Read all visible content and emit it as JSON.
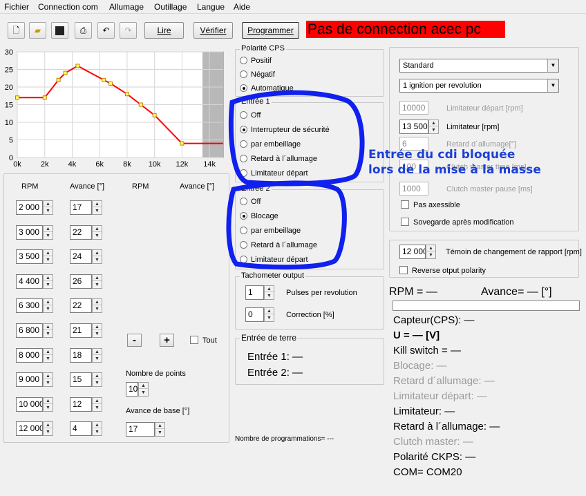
{
  "menu": [
    "Fichier",
    "Connection com",
    "Allumage",
    "Outillage",
    "Langue",
    "Aide"
  ],
  "toolbar": {
    "read_label": "Lire",
    "verify_label": "Vérifier",
    "program_label": "Programmer",
    "status": "Pas de connection acec pc",
    "status_color": "#ff0000"
  },
  "chart_data": {
    "type": "line",
    "x": [
      0,
      2000,
      3000,
      3500,
      4400,
      6300,
      6800,
      8000,
      9000,
      10000,
      12000,
      15000
    ],
    "values": [
      17,
      17,
      22,
      24,
      26,
      22,
      21,
      18,
      15,
      12,
      4,
      4
    ],
    "ylim": [
      0,
      30
    ],
    "xlim": [
      0,
      15000
    ],
    "yticks": [
      "0",
      "5",
      "10",
      "15",
      "20",
      "25",
      "30"
    ],
    "xticks": [
      "0k",
      "2k",
      "4k",
      "6k",
      "8k",
      "10k",
      "12k",
      "14k"
    ],
    "grid": true,
    "line_color": "#ff0000"
  },
  "table": {
    "headers": [
      "RPM",
      "Avance [°]",
      "RPM",
      "Avance [°]"
    ],
    "rows": [
      {
        "rpm": "2 000",
        "adv": "17"
      },
      {
        "rpm": "3 000",
        "adv": "22"
      },
      {
        "rpm": "3 500",
        "adv": "24"
      },
      {
        "rpm": "4 400",
        "adv": "26"
      },
      {
        "rpm": "6 300",
        "adv": "22"
      },
      {
        "rpm": "6 800",
        "adv": "21"
      },
      {
        "rpm": "8 000",
        "adv": "18"
      },
      {
        "rpm": "9 000",
        "adv": "15"
      },
      {
        "rpm": "10 000",
        "adv": "12"
      },
      {
        "rpm": "12 000",
        "adv": "4"
      }
    ],
    "minus": "-",
    "plus": "+",
    "tout": "Tout",
    "nb_points_label": "Nombre de points",
    "nb_points_value": "10",
    "base_adv_label": "Avance de base [°]",
    "base_adv_value": "17"
  },
  "polarite": {
    "title": "Polarité CPS",
    "options": [
      "Positif",
      "Négatif",
      "Automatique"
    ],
    "selected": 2
  },
  "entree1": {
    "title": "Entrée 1",
    "options": [
      "Off",
      "Interrupteur de sécurité",
      "par embeillage",
      "Retard à l´allumage",
      "Limitateur départ"
    ],
    "selected": 1
  },
  "entree2": {
    "title": "Entrée 2",
    "options": [
      "Off",
      "Blocage",
      "par embeillage",
      "Retard à l´allumage",
      "Limitateur départ"
    ],
    "selected": 1
  },
  "tacho": {
    "title": "Tachometer output",
    "pulses_value": "1",
    "pulses_label": "Pulses per revolution",
    "corr_value": "0",
    "corr_label": "Correction [%]"
  },
  "terre": {
    "title": "Entrée de terre",
    "e1": "Entrée 1: —",
    "e2": "Entrée 2: —"
  },
  "prog_count": "Nombre de programmations=  ---",
  "settings": {
    "combo1": "Standard",
    "combo2": "1 ignition per revolution",
    "lim_depart_value": "10000",
    "lim_depart_label": "Limitateur départ [rpm]",
    "limiter_value": "13 500",
    "limiter_label": "Limitateur [rpm]",
    "retard_value": "6",
    "retard_label": "Retard d´allumage[°]",
    "hidden_value": "100",
    "hidden_label": "Clutch master time [ms]",
    "pause_value": "1000",
    "pause_label": "Clutch master pause [ms]",
    "pas_axessible": "Pas axessible",
    "sovegarde": "Sovegarde après modification"
  },
  "gear": {
    "value": "12 000",
    "label": "Témoin de changement de rapport [rpm]",
    "reverse": "Reverse otput polarity"
  },
  "status_panel": {
    "rpm": "RPM = —",
    "avance": "Avance= — [°]",
    "capteur": "Capteur(CPS): —",
    "u": "U = — [V]",
    "kill": "Kill switch = —",
    "blocage": "Blocage: —",
    "retard": "Retard d´allumage: —",
    "limdep": "Limitateur départ: —",
    "limitateur": "Limitateur: —",
    "retard2": "Retard à l´allumage: —",
    "clutch": "Clutch master: —",
    "polarite": "Polarité CKPS: —",
    "com": "COM= COM20"
  },
  "annotation": {
    "line1": "Entrée du cdi bloquée",
    "line2": "lors de la mise à la masse",
    "color": "#1c3fd6"
  }
}
